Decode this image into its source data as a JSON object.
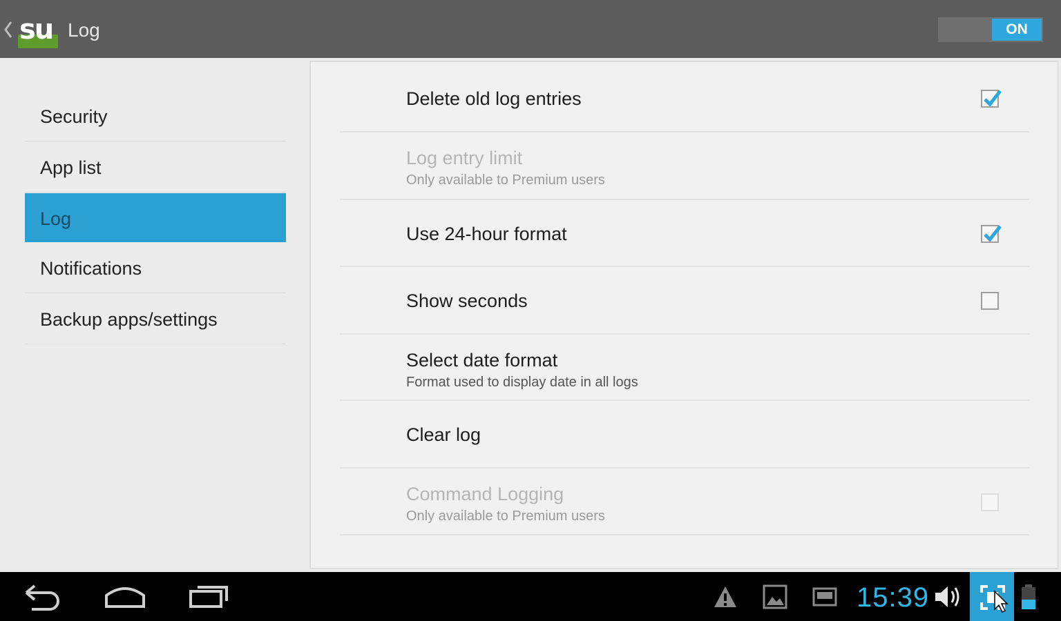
{
  "actionbar": {
    "logo_text": "su",
    "title": "Log",
    "switch_label": "ON",
    "switch_state": "on"
  },
  "headers": {
    "items": [
      {
        "label": "Security"
      },
      {
        "label": "App list"
      },
      {
        "label": "Log",
        "selected": true
      },
      {
        "label": "Notifications"
      },
      {
        "label": "Backup apps/settings"
      }
    ]
  },
  "prefs": {
    "delete_old": {
      "title": "Delete old log entries",
      "checked": true
    },
    "entry_limit": {
      "title": "Log entry limit",
      "summary": "Only available to Premium users",
      "enabled": false
    },
    "use_24h": {
      "title": "Use 24-hour format",
      "checked": true
    },
    "show_seconds": {
      "title": "Show seconds",
      "checked": false
    },
    "date_format": {
      "title": "Select date format",
      "summary": "Format used to display date in all logs"
    },
    "clear_log": {
      "title": "Clear log"
    },
    "command_logging": {
      "title": "Command Logging",
      "summary": "Only available to Premium users",
      "enabled": false,
      "checked": false
    }
  },
  "navbar": {
    "clock": "15:39",
    "icons": [
      "back-icon",
      "home-icon",
      "recents-icon",
      "warning-icon",
      "gallery-icon",
      "screen-icon",
      "volume-icon",
      "screenshot-icon",
      "battery-icon"
    ]
  },
  "colors": {
    "accent": "#2aa0d3",
    "clock": "#31b6e7",
    "actionbar": "#5c5c5c",
    "su_green": "#5f9b2d"
  }
}
